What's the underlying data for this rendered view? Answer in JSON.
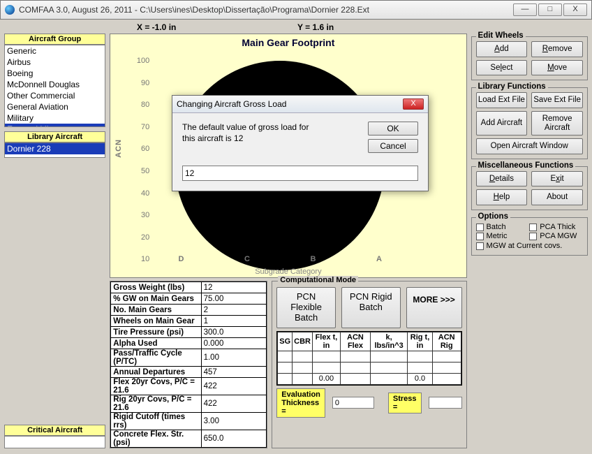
{
  "window": {
    "title": "COMFAA 3.0, August 26, 2011 - C:\\Users\\ines\\Desktop\\Dissertação\\Programa\\Dornier 228.Ext",
    "min": "—",
    "max": "□",
    "close": "X"
  },
  "coords": {
    "x": "X = -1.0 in",
    "y": "Y = 1.6 in"
  },
  "left": {
    "aircraft_group_title": "Aircraft Group",
    "groups": [
      "Generic",
      "Airbus",
      "Boeing",
      "McDonnell Douglas",
      "Other Commercial",
      "General Aviation",
      "Military",
      "External Library"
    ],
    "groups_selected_index": 7,
    "library_aircraft_title": "Library Aircraft",
    "library_items": [
      "Dornier 228"
    ],
    "library_selected_index": 0,
    "critical_title": "Critical Aircraft"
  },
  "chart_data": {
    "type": "scatter",
    "title": "Main Gear Footprint",
    "ylabel": "ACN",
    "xlabel": "Subgrade Category",
    "y_ticks": [
      10,
      20,
      30,
      40,
      50,
      60,
      70,
      80,
      90,
      100
    ],
    "x_categories": [
      "D",
      "C",
      "B",
      "A"
    ]
  },
  "params": [
    {
      "label": "Gross Weight (lbs)",
      "value": "12"
    },
    {
      "label": "% GW on Main Gears",
      "value": "75.00"
    },
    {
      "label": "No. Main Gears",
      "value": "2"
    },
    {
      "label": "Wheels on Main Gear",
      "value": "1"
    },
    {
      "label": "Tire Pressure (psi)",
      "value": "300.0"
    },
    {
      "label": "Alpha Used",
      "value": "0.000"
    },
    {
      "label": "Pass/Traffic Cycle (P/TC)",
      "value": "1.00"
    },
    {
      "label": "Annual Departures",
      "value": "457"
    },
    {
      "label": "Flex 20yr Covs, P/C = 21.6",
      "value": "422"
    },
    {
      "label": "Rig 20yr Covs,  P/C = 21.6",
      "value": "422"
    },
    {
      "label": "Rigid Cutoff (times rrs)",
      "value": "3.00"
    },
    {
      "label": "Concrete Flex. Str. (psi)",
      "value": "650.0"
    }
  ],
  "right": {
    "edit_wheels": {
      "title": "Edit Wheels",
      "add": "Add",
      "remove": "Remove",
      "select": "Select",
      "move": "Move"
    },
    "library": {
      "title": "Library Functions",
      "load": "Load Ext File",
      "save": "Save Ext File",
      "add_ac": "Add Aircraft",
      "remove_ac": "Remove Aircraft",
      "open": "Open Aircraft Window"
    },
    "misc": {
      "title": "Miscellaneous Functions",
      "details": "Details",
      "exit": "Exit",
      "help": "Help",
      "about": "About"
    },
    "options": {
      "title": "Options",
      "batch": "Batch",
      "pca_thick": "PCA Thick",
      "metric": "Metric",
      "pca_mgw": "PCA MGW",
      "mgw_cov": "MGW at Current covs."
    }
  },
  "comp": {
    "title": "Computational Mode",
    "flex": "PCN Flexible Batch",
    "rigid": "PCN Rigid Batch",
    "more": "MORE >>>",
    "cols": [
      "SG",
      "CBR",
      "Flex t, in",
      "ACN Flex",
      "k, lbs/in^3",
      "Rig t, in",
      "ACN Rig"
    ],
    "row_flex": "0.00",
    "row_rig": "0.0",
    "eval_label": "Evaluation Thickness =",
    "eval_value": "0",
    "stress_label": "Stress =",
    "stress_value": ""
  },
  "modal": {
    "title": "Changing Aircraft Gross Load",
    "msg1": "The default value of gross load for",
    "msg2": "this aircraft is 12",
    "ok": "OK",
    "cancel": "Cancel",
    "input": "12"
  }
}
